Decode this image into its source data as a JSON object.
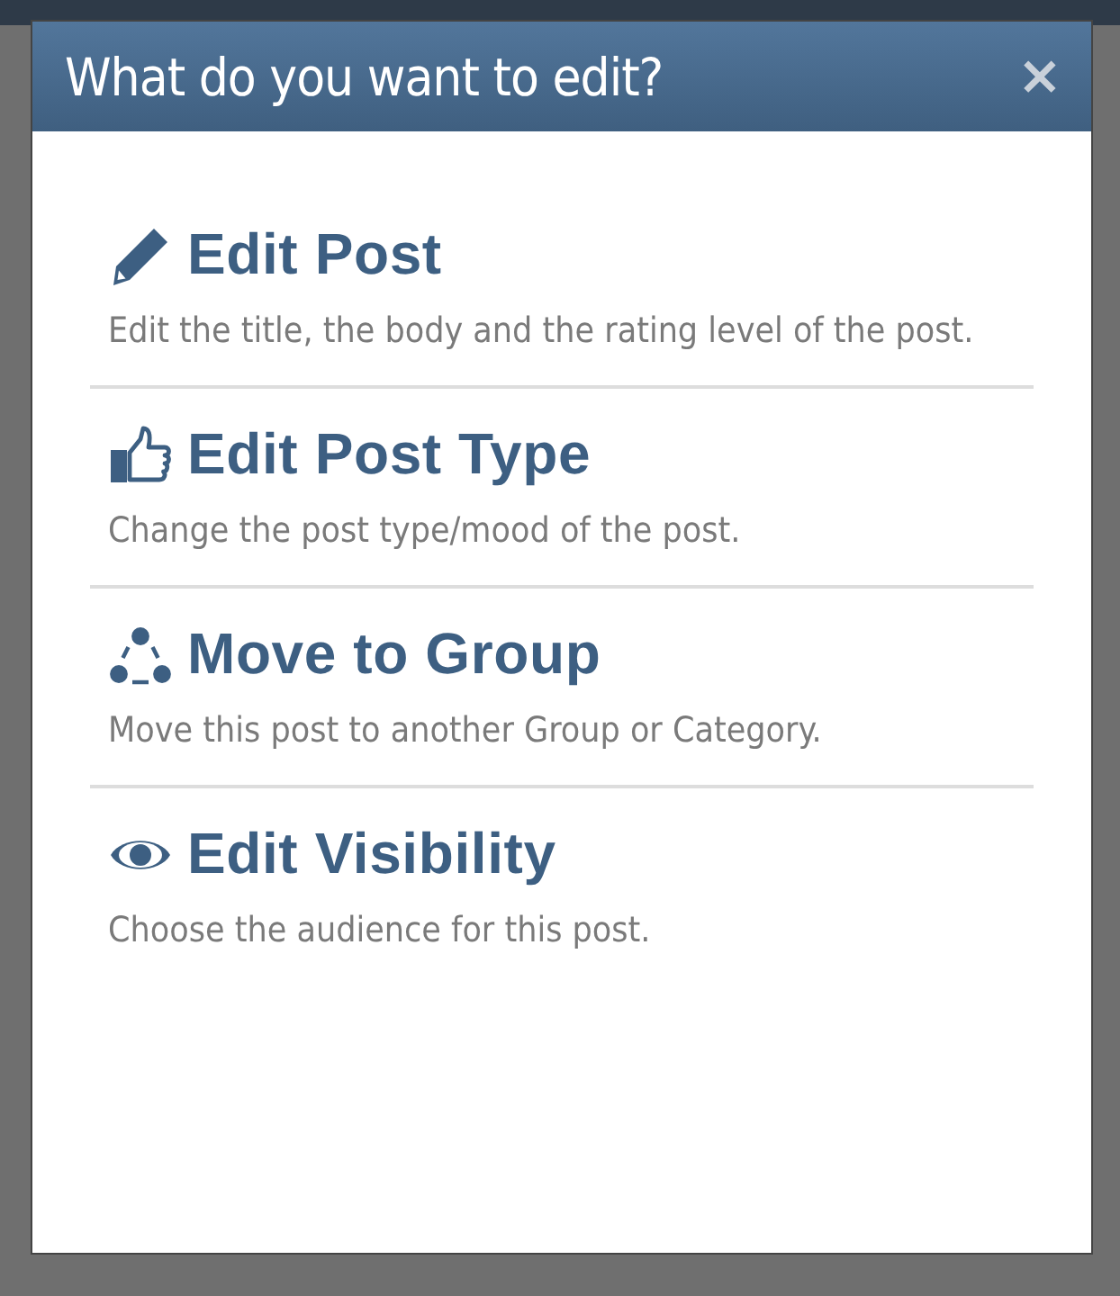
{
  "dialog": {
    "title": "What do you want to edit?",
    "close": "×",
    "options": [
      {
        "title": "Edit Post",
        "description": "Edit the title, the body and the rating level of the post."
      },
      {
        "title": "Edit Post Type",
        "description": "Change the post type/mood of the post."
      },
      {
        "title": "Move to Group",
        "description": "Move this post to another Group or Category."
      },
      {
        "title": "Edit Visibility",
        "description": "Choose the audience for this post."
      }
    ]
  }
}
